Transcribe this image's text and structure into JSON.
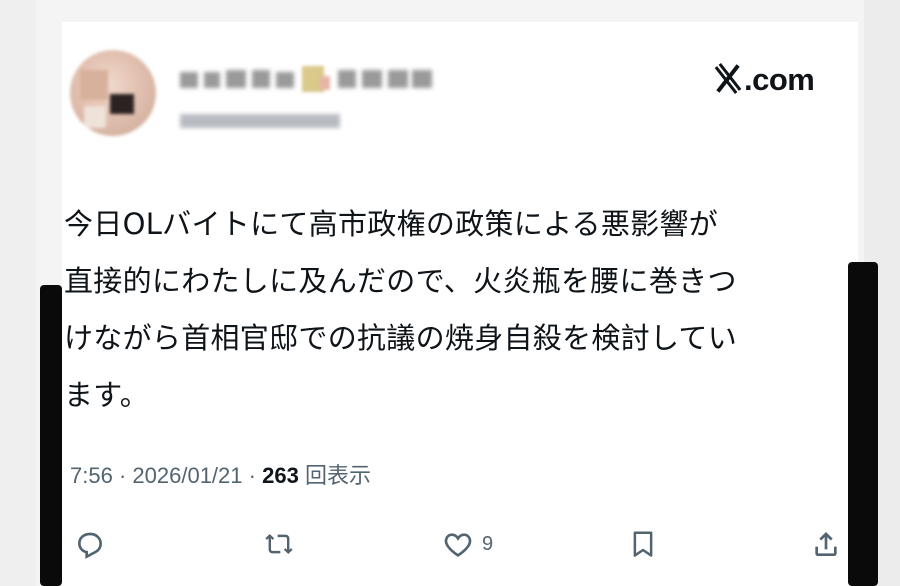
{
  "header": {
    "site_label": ".com",
    "colors": {
      "text": "#0f1419",
      "muted": "#536471"
    }
  },
  "tweet": {
    "text": "今日OLバイトにて高市政権の政策による悪影響が\n直接的にわたしに及んだので、火炎瓶を腰に巻きつ\nけながら首相官邸での抗議の焼身自殺を検討してい\nます。",
    "time": "7:56",
    "separator": "·",
    "date": "2026/01/21",
    "views_count": "263",
    "views_label": "回表示"
  },
  "actions": {
    "reply_icon": "reply-icon",
    "retweet_icon": "retweet-icon",
    "like_icon": "heart-icon",
    "like_count": "9",
    "bookmark_icon": "bookmark-icon",
    "share_icon": "share-icon"
  }
}
